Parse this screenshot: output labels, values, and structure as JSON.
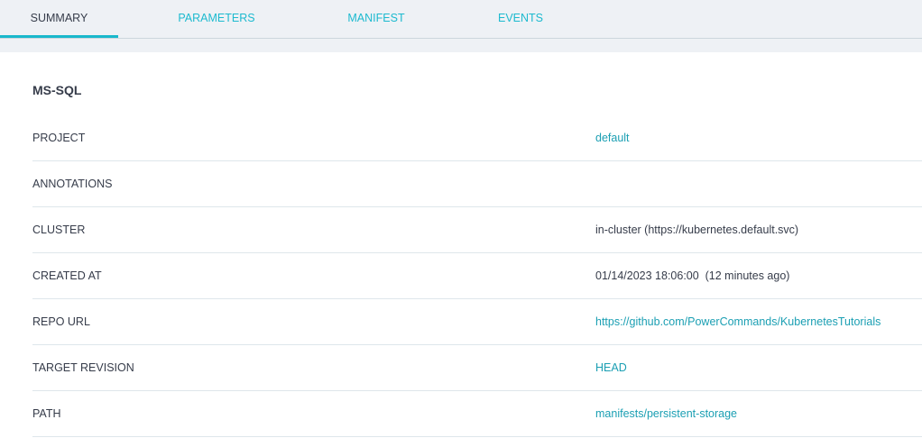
{
  "tabs": [
    "SUMMARY",
    "PARAMETERS",
    "MANIFEST",
    "EVENTS"
  ],
  "title": "MS-SQL",
  "rows": [
    {
      "label": "PROJECT",
      "value": "default"
    },
    {
      "label": "ANNOTATIONS",
      "value": ""
    },
    {
      "label": "CLUSTER",
      "value": "in-cluster (https://kubernetes.default.svc)"
    },
    {
      "label": "CREATED AT",
      "value": "01/14/2023 18:06:00  (12 minutes ago)"
    },
    {
      "label": "REPO URL",
      "value": "https://github.com/PowerCommands/KubernetesTutorials"
    },
    {
      "label": "TARGET REVISION",
      "value": "HEAD"
    },
    {
      "label": "PATH",
      "value": "manifests/persistent-storage"
    }
  ]
}
